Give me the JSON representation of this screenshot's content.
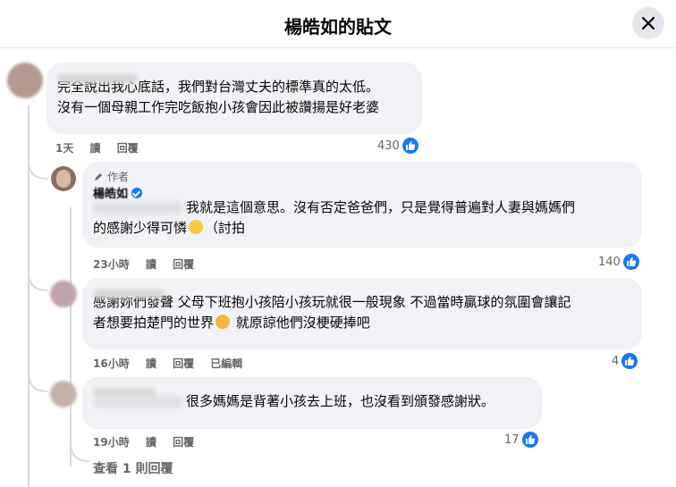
{
  "header": {
    "title": "楊皓如的貼文"
  },
  "comments": [
    {
      "line1": "完全說出我心底話，我們對台灣丈夫的標準真的太低。",
      "line2": "沒有一個母親工作完吃飯抱小孩會因此被讚揚是好老婆",
      "time": "1天",
      "read": "讀",
      "reply": "回覆",
      "likes": "430"
    },
    {
      "author_label": "作者",
      "author_name": "楊皓如",
      "line1": "我就是這個意思。沒有否定爸爸們，只是覺得普遍對人妻與媽媽們",
      "line2a": "的感謝少得可憐",
      "line2b": "（討拍",
      "time": "23小時",
      "read": "讀",
      "reply": "回覆",
      "likes": "140"
    },
    {
      "line1": "感謝妳們發聲 父母下班抱小孩陪小孩玩就很一般現象 不過當時贏球的氛圍會讓記",
      "line2a": "者想要拍楚門的世界",
      "line2b": " 就原諒他們沒梗硬捧吧",
      "time": "16小時",
      "read": "讀",
      "reply": "回覆",
      "edited": "已編輯",
      "likes": "4"
    },
    {
      "line1": "很多媽媽是背著小孩去上班，也沒看到頒發感謝狀。",
      "time": "19小時",
      "read": "讀",
      "reply": "回覆",
      "likes": "17"
    }
  ],
  "view_replies": "查看 1 則回覆",
  "icons": {
    "close": "close-icon",
    "like": "like-thumb-icon",
    "pencil": "pencil-icon",
    "verified": "verified-badge-icon"
  },
  "colors": {
    "accent": "#1877f2",
    "bubble": "#f0f2f5",
    "meta": "#65676b"
  }
}
